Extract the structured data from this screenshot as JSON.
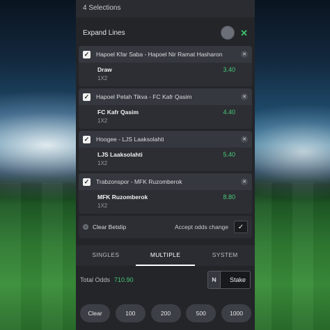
{
  "header": {
    "selections": "4 Selections"
  },
  "expand": {
    "label": "Expand Lines",
    "close": "✕"
  },
  "selections": [
    {
      "match": "Hapoel Kfar Saba - Hapoel Nir Ramat Hasharon",
      "pick": "Draw",
      "market": "1X2",
      "odds": "3.40"
    },
    {
      "match": "Hapoel Petah Tikva - FC Kafr Qasim",
      "pick": "FC Kafr Qasim",
      "market": "1X2",
      "odds": "4.40"
    },
    {
      "match": "Hoogee - LJS Laaksolahti",
      "pick": "LJS Laaksolahti",
      "market": "1X2",
      "odds": "5.40"
    },
    {
      "match": "Trabzonspor - MFK Ruzomberok",
      "pick": "MFK Ruzomberok",
      "market": "1X2",
      "odds": "8.80"
    }
  ],
  "actions": {
    "clear_betslip": "Clear Betslip",
    "accept_odds": "Accept odds change"
  },
  "tabs": [
    "SINGLES",
    "MULTIPLE",
    "SYSTEM"
  ],
  "active_tab": "MULTIPLE",
  "totals": {
    "label": "Total Odds",
    "value": "710.90"
  },
  "stake": {
    "currency": "₦",
    "label": "Stake"
  },
  "quick_amounts": [
    "Clear",
    "100",
    "200",
    "500",
    "1000"
  ],
  "colors": {
    "accent_green": "#48c978",
    "panel": "#232529"
  }
}
